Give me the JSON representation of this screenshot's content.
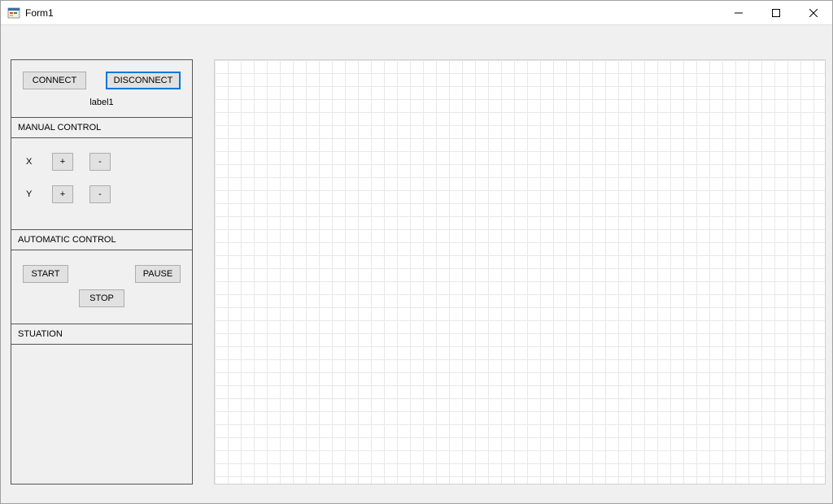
{
  "window": {
    "title": "Form1"
  },
  "connection": {
    "connect_label": "CONNECT",
    "disconnect_label": "DISCONNECT",
    "status_label": "label1"
  },
  "manual": {
    "header": "MANUAL CONTROL",
    "x_label": "X",
    "y_label": "Y",
    "plus_label": "+",
    "minus_label": "-"
  },
  "automatic": {
    "header": "AUTOMATIC CONTROL",
    "start_label": "START",
    "pause_label": "PAUSE",
    "stop_label": "STOP"
  },
  "situation": {
    "header": "STUATION"
  },
  "chart_data": {
    "type": "scatter",
    "series": [],
    "title": "",
    "xlabel": "",
    "ylabel": "",
    "grid": true
  }
}
